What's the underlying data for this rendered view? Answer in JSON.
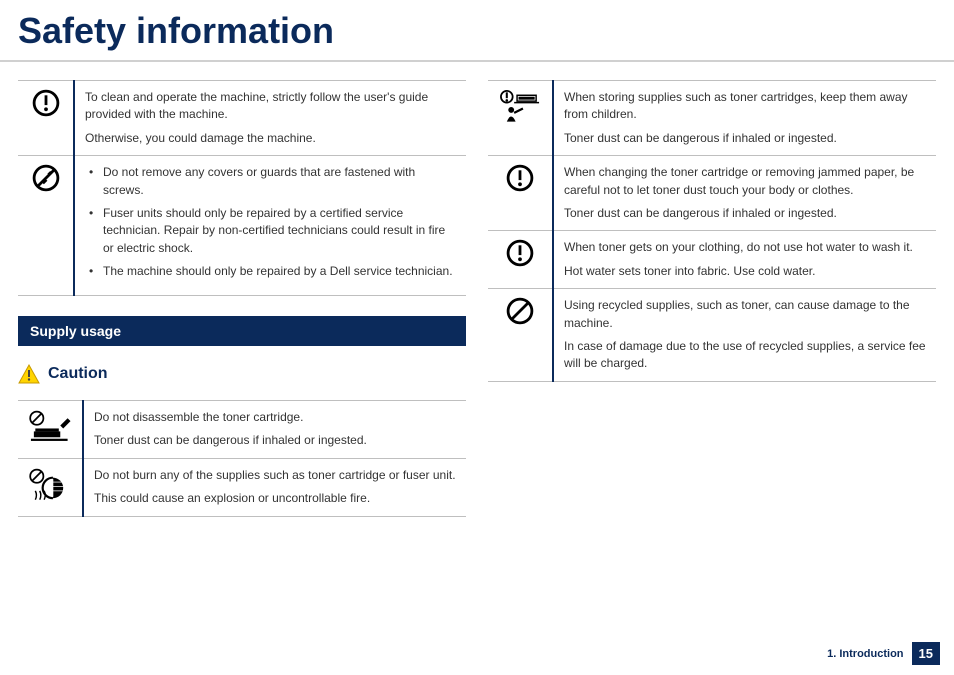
{
  "title": "Safety information",
  "left": {
    "rows_top": [
      {
        "lines": [
          "To clean and operate the machine, strictly follow the user's guide provided with the machine.",
          "Otherwise, you could damage the machine."
        ]
      },
      {
        "bullets": [
          "Do not remove any covers or guards that are fastened with screws.",
          "Fuser units should only be repaired by a certified service technician. Repair by non-certified technicians could result in fire or electric shock.",
          "The machine should only be repaired by a Dell service technician."
        ]
      }
    ],
    "section_bar": "Supply usage",
    "caution_label": "Caution",
    "rows_bottom": [
      {
        "lines": [
          "Do not disassemble the toner cartridge.",
          "Toner dust can be dangerous if inhaled or ingested."
        ]
      },
      {
        "lines": [
          "Do not burn any of the supplies such as toner cartridge or fuser unit.",
          "This could cause an explosion or uncontrollable fire."
        ]
      }
    ]
  },
  "right": {
    "rows": [
      {
        "lines": [
          "When storing supplies such as toner cartridges, keep them away from children.",
          "Toner dust can be dangerous if inhaled or ingested."
        ]
      },
      {
        "lines": [
          "When changing the toner cartridge or removing jammed paper, be careful not to let toner dust touch your body or clothes.",
          "Toner dust can be dangerous if inhaled or ingested."
        ]
      },
      {
        "lines": [
          "When toner gets on your clothing, do not use hot water to wash it.",
          "Hot water sets toner into fabric. Use cold water."
        ]
      },
      {
        "lines": [
          "Using recycled supplies, such as toner, can cause damage to the machine.",
          "In case of damage due to the use of recycled supplies, a service fee will be charged."
        ]
      }
    ]
  },
  "footer": {
    "chapter": "1. Introduction",
    "page": "15"
  }
}
